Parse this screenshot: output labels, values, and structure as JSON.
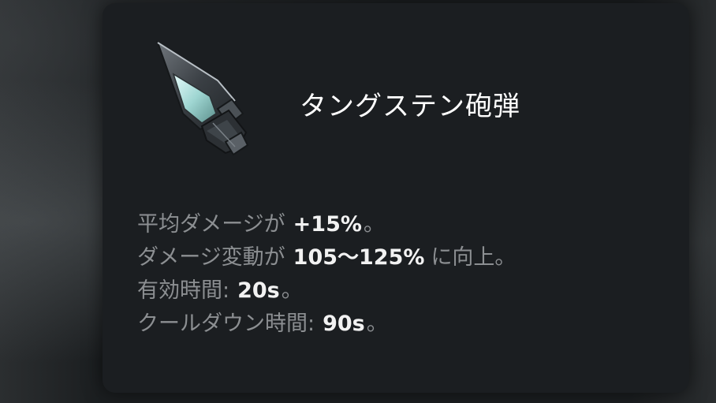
{
  "item": {
    "name": "タングステン砲弾",
    "icon": "tungsten-shell-icon"
  },
  "stats": [
    {
      "label": "平均ダメージが",
      "value": "+15%",
      "suffix": "。"
    },
    {
      "label": "ダメージ変動が",
      "value": "105〜125%",
      "suffix": "に向上。"
    },
    {
      "label": "有効時間:",
      "value": "20s",
      "suffix": "。"
    },
    {
      "label": "クールダウン時間:",
      "value": "90s",
      "suffix": "。"
    }
  ],
  "colors": {
    "panel": "#1b1e21",
    "title": "#ffffff",
    "label": "#8c8f92",
    "value": "#f2f2f2"
  }
}
